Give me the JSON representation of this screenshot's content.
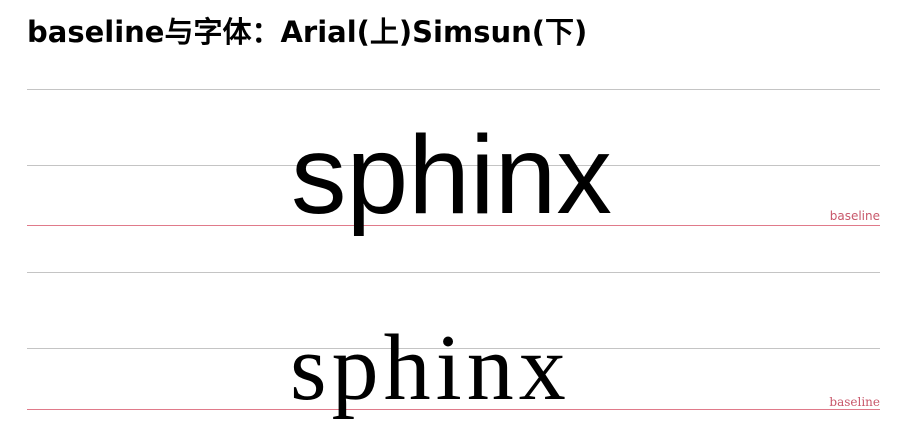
{
  "title": "baseline与字体：Arial(上)Simsun(下)",
  "sample_word": "sphinx",
  "baseline_label": "baseline",
  "colors": {
    "guide_line": "#c4c4c4",
    "baseline_line": "#e07a8a",
    "baseline_text": "#c8576a"
  }
}
